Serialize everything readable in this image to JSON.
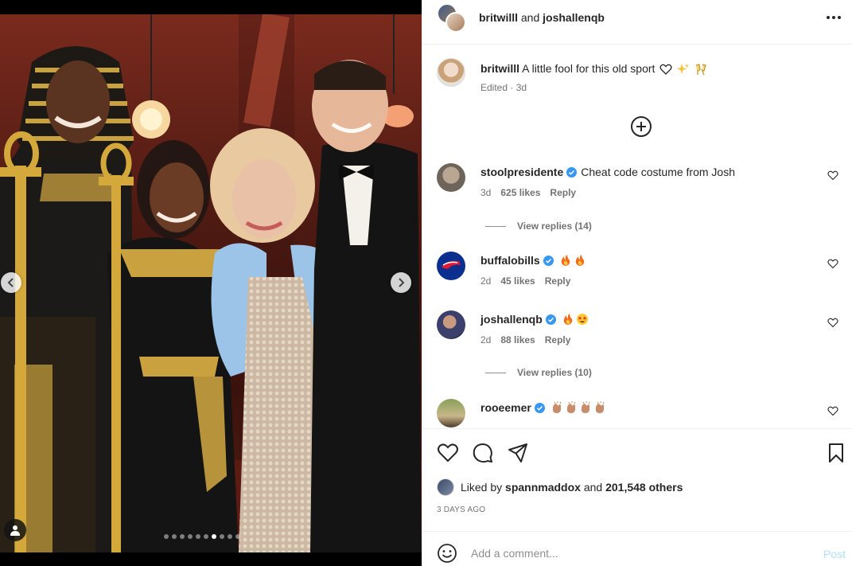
{
  "header": {
    "user1": "britwilll",
    "and_label": "and",
    "user2": "joshallenqb"
  },
  "caption": {
    "user": "britwilll",
    "text": "A little fool for this old sport",
    "meta": "Edited · 3d"
  },
  "comments": [
    {
      "user": "stoolpresidente",
      "verified": true,
      "text": "Cheat code costume from Josh",
      "time": "3d",
      "likes": "625 likes",
      "reply_label": "Reply",
      "view_replies": "View replies (14)"
    },
    {
      "user": "buffalobills",
      "verified": true,
      "text": "",
      "emojis": [
        "fire",
        "fire"
      ],
      "time": "2d",
      "likes": "45 likes",
      "reply_label": "Reply"
    },
    {
      "user": "joshallenqb",
      "verified": true,
      "text": "",
      "emojis": [
        "fire",
        "star-struck"
      ],
      "time": "2d",
      "likes": "88 likes",
      "reply_label": "Reply",
      "view_replies": "View replies (10)"
    },
    {
      "user": "rooeemer",
      "verified": true,
      "text": "",
      "emojis": [
        "clap",
        "clap",
        "clap",
        "clap"
      ]
    }
  ],
  "actions": {
    "liked_prefix": "Liked by",
    "liked_user": "spannmaddox",
    "liked_and": "and",
    "liked_others": "201,548 others",
    "time_ago": "3 DAYS AGO"
  },
  "add_comment": {
    "placeholder": "Add a comment...",
    "post_label": "Post"
  },
  "carousel": {
    "total_slides": 10,
    "active_slide": 7
  },
  "colors": {
    "verified": "#3897f0",
    "post_disabled": "#b2dffc",
    "secondary_text": "#737373"
  }
}
